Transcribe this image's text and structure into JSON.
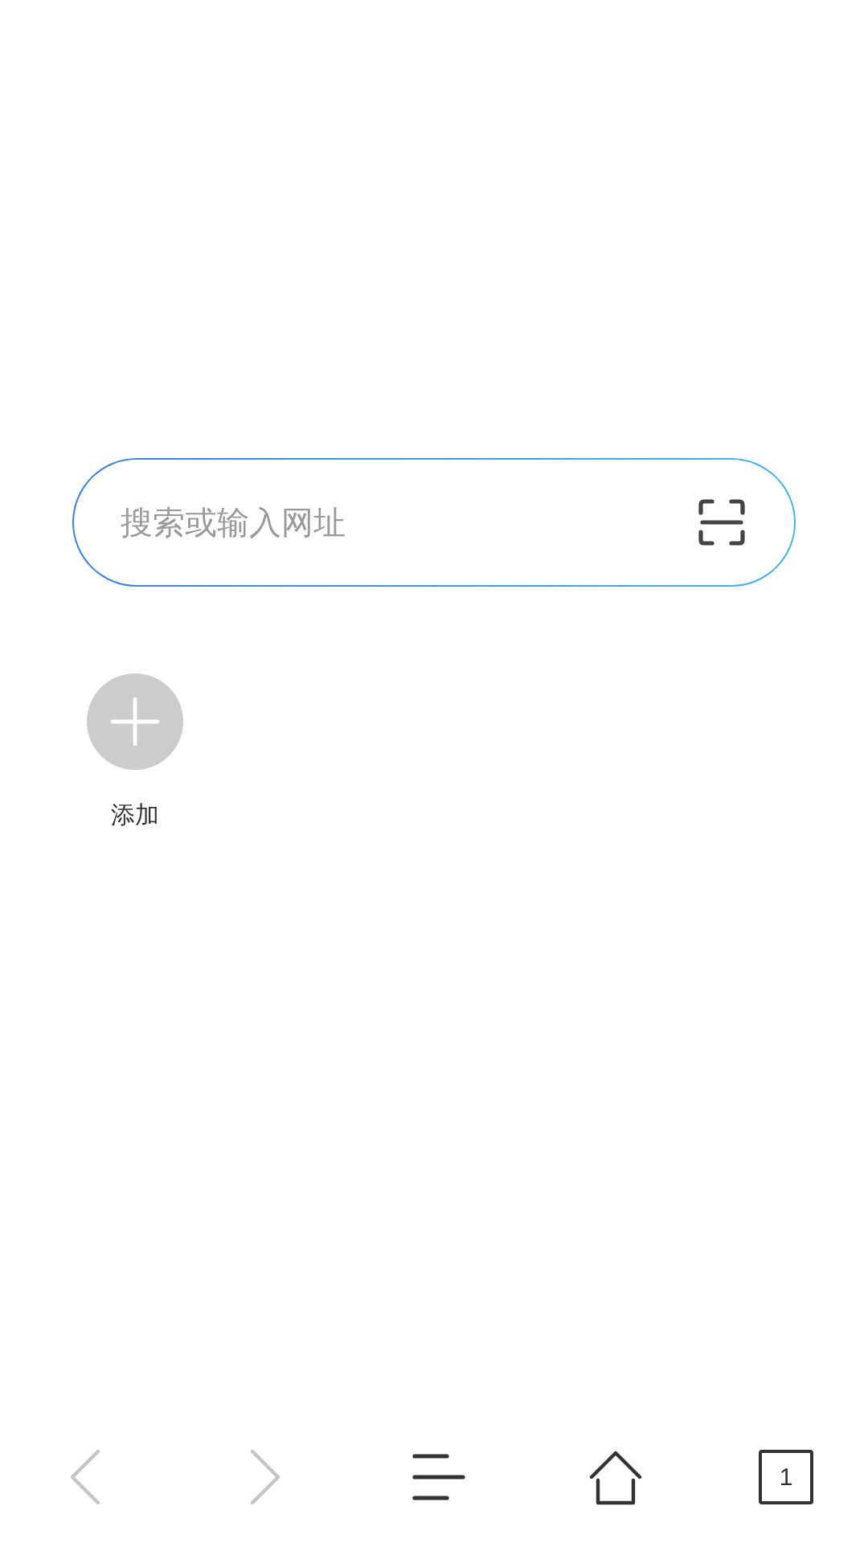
{
  "search": {
    "placeholder": "搜索或输入网址"
  },
  "shortcuts": [
    {
      "label": "添加",
      "kind": "add"
    }
  ],
  "toolbar": [
    {
      "kind": "back",
      "disabled": true
    },
    {
      "kind": "forward",
      "disabled": true
    },
    {
      "kind": "menu",
      "disabled": false
    },
    {
      "kind": "home",
      "disabled": false
    },
    {
      "kind": "tabs",
      "disabled": false,
      "count": "1"
    }
  ]
}
